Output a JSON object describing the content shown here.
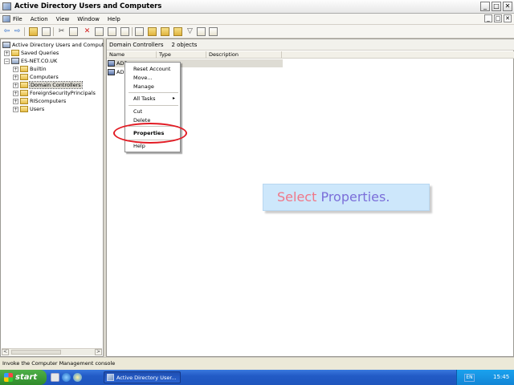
{
  "window": {
    "title": "Active Directory Users and Computers",
    "min": "_",
    "max": "□",
    "close": "✕"
  },
  "menubar": {
    "items": [
      "File",
      "Action",
      "View",
      "Window",
      "Help"
    ],
    "mdi": [
      "_",
      "□",
      "✕"
    ]
  },
  "toolbar": {
    "back": "⇦",
    "forward": "⇨"
  },
  "tree": {
    "items": [
      {
        "label": "Active Directory Users and Computers",
        "expander": "",
        "icon": "computer"
      },
      {
        "label": "Saved Queries",
        "expander": "+",
        "icon": "folder"
      },
      {
        "label": "ES-NET.CO.UK",
        "expander": "−",
        "icon": "computer"
      },
      {
        "label": "Builtin",
        "expander": "+",
        "icon": "folder"
      },
      {
        "label": "Computers",
        "expander": "+",
        "icon": "folder"
      },
      {
        "label": "Domain Controllers",
        "expander": "+",
        "icon": "folder",
        "selected": true
      },
      {
        "label": "ForeignSecurityPrincipals",
        "expander": "+",
        "icon": "folder"
      },
      {
        "label": "RIScomputers",
        "expander": "+",
        "icon": "folder"
      },
      {
        "label": "Users",
        "expander": "+",
        "icon": "folder"
      }
    ],
    "scroll_left": "<",
    "scroll_right": ">"
  },
  "right": {
    "header_title": "Domain Controllers",
    "header_count": "2 objects",
    "columns": [
      "Name",
      "Type",
      "Description"
    ],
    "rows": [
      "ADP",
      "ADI"
    ]
  },
  "context_menu": {
    "items": [
      "Reset Account",
      "Move...",
      "Manage",
      "All Tasks",
      "Cut",
      "Delete",
      "Properties",
      "Help"
    ],
    "submenu_arrow": "▸"
  },
  "callout": {
    "word1": "Select",
    "word2": "Properties."
  },
  "statusbar": {
    "text": "Invoke the Computer Management console"
  },
  "taskbar": {
    "start": "start",
    "task": "Active Directory User...",
    "language": "EN",
    "clock": "15:45"
  }
}
